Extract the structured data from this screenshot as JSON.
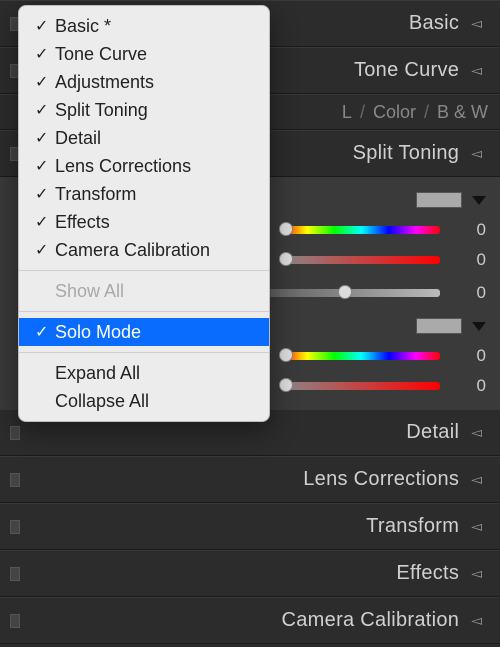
{
  "panels": {
    "basic": "Basic",
    "tone_curve": "Tone Curve",
    "split_toning": "Split Toning",
    "detail": "Detail",
    "lens_corrections": "Lens Corrections",
    "transform": "Transform",
    "effects": "Effects",
    "camera_calibration": "Camera Calibration"
  },
  "tabs": {
    "hsl_partial": "L",
    "color": "Color",
    "bw": "B & W",
    "sep": "/"
  },
  "split": {
    "highlights": {
      "hue": 0,
      "sat": 0
    },
    "balance": 0,
    "shadows": {
      "hue": 0,
      "sat": 0
    }
  },
  "disclosure_glyph": "◅",
  "context_menu": {
    "items": [
      {
        "label": "Basic *",
        "checked": true
      },
      {
        "label": "Tone Curve",
        "checked": true
      },
      {
        "label": "Adjustments",
        "checked": true
      },
      {
        "label": "Split Toning",
        "checked": true
      },
      {
        "label": "Detail",
        "checked": true
      },
      {
        "label": "Lens Corrections",
        "checked": true
      },
      {
        "label": "Transform",
        "checked": true
      },
      {
        "label": "Effects",
        "checked": true
      },
      {
        "label": "Camera Calibration",
        "checked": true
      }
    ],
    "show_all": "Show All",
    "solo_mode": "Solo Mode",
    "expand_all": "Expand All",
    "collapse_all": "Collapse All",
    "check_glyph": "✓"
  }
}
